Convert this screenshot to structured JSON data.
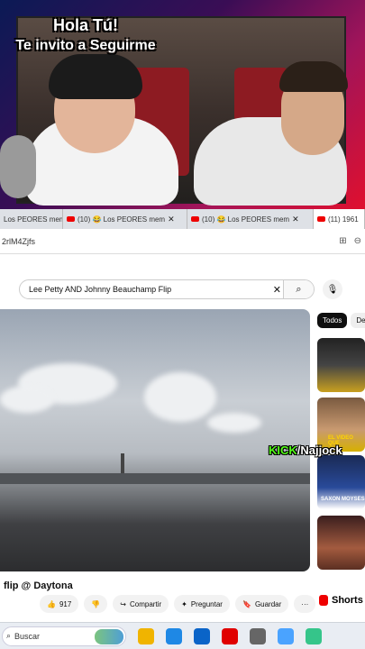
{
  "overlay": {
    "line1": "Hola Tú!",
    "line2": "Te invito a Seguirme"
  },
  "browser": {
    "tabs": [
      {
        "label": "Los PEORES mem",
        "active": false
      },
      {
        "label": "(10) 😂 Los PEORES mem",
        "active": false
      },
      {
        "label": "(10) 😂 Los PEORES mem",
        "active": false
      },
      {
        "label": "(11) 1961",
        "active": true
      }
    ],
    "address": "2rlM4Zjfs"
  },
  "youtube": {
    "search_value": "Lee Petty AND Johnny Beauchamp Flip",
    "chips": [
      "Todos",
      "De"
    ],
    "video_title": "flip @ Daytona",
    "like_count": "917",
    "share_label": "Compartir",
    "ask_label": "Preguntar",
    "save_label": "Guardar",
    "more_label": "···",
    "shorts_label": "Shorts",
    "thumb_texts": [
      "EL VIDEO QUE",
      "SAXON MOYSES"
    ],
    "kick_prefix": "KICK",
    "kick_user": "/Najjock"
  },
  "taskbar": {
    "search_placeholder": "Buscar"
  },
  "colors": {
    "youtube_red": "#e00000",
    "kick_green": "#53fc18"
  }
}
